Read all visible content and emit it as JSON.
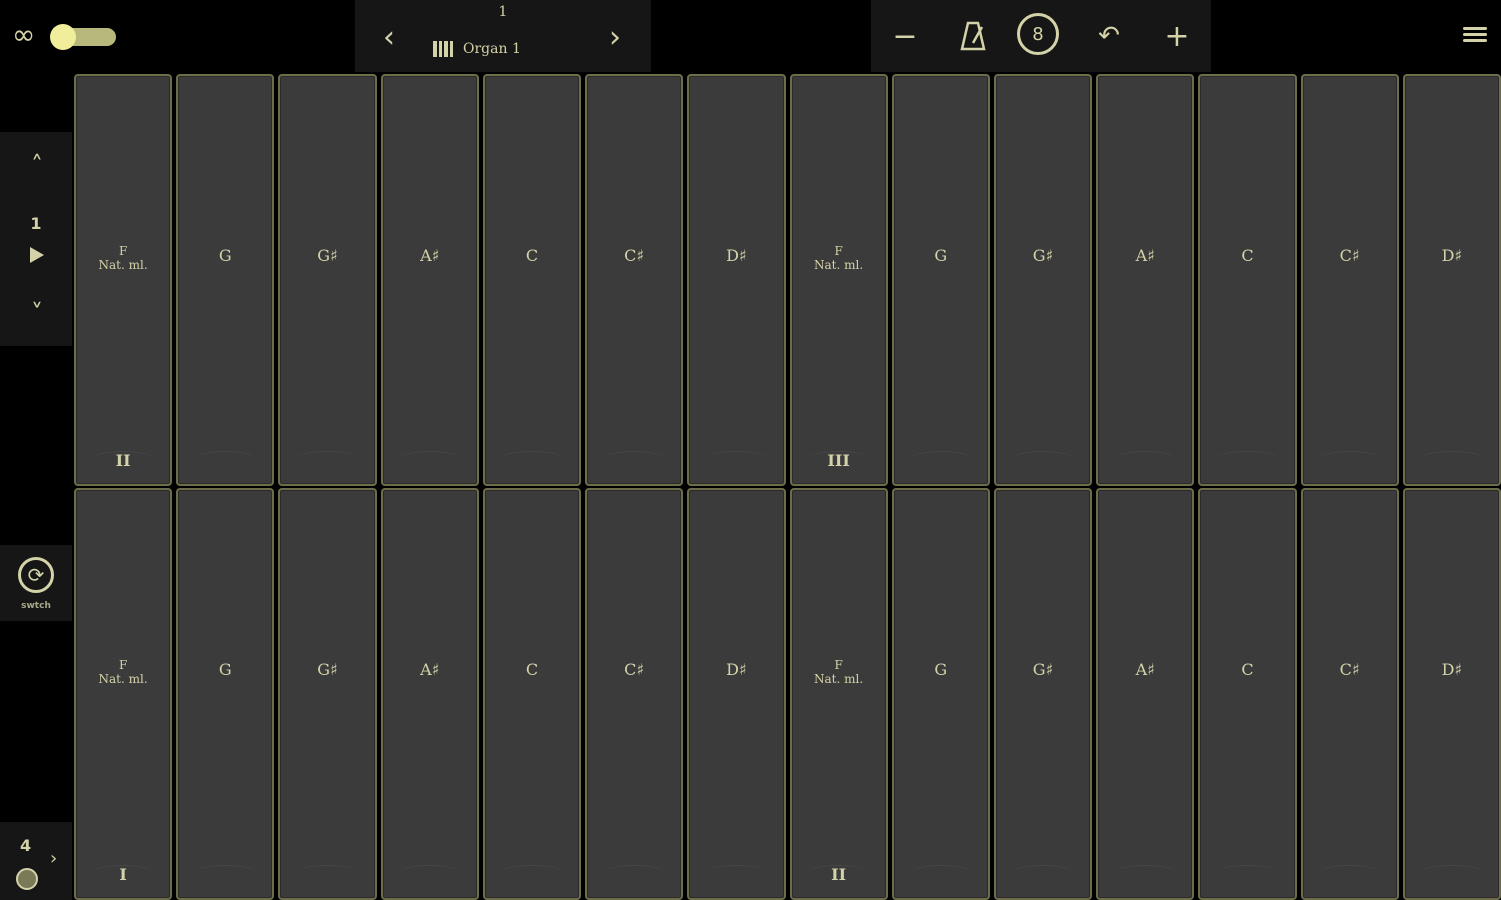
{
  "loop": {
    "infinity_symbol": "∞"
  },
  "preset": {
    "number": "1",
    "name": "Organ 1",
    "prev_symbol": "‹",
    "next_symbol": "›"
  },
  "tempo": {
    "minus_symbol": "−",
    "metronome_symbol": "𝄐",
    "count": "8",
    "undo_symbol": "↶",
    "plus_symbol": "+"
  },
  "octave": {
    "up_symbol": "˄",
    "down_symbol": "˅",
    "value": "1"
  },
  "swap": {
    "label": "swtch",
    "symbol": "⟳"
  },
  "bottom_left": {
    "number": "4",
    "chevron": "›"
  },
  "rows": {
    "top": [
      {
        "label": "F\nNat. ml.",
        "roman": "II"
      },
      {
        "label": "G",
        "roman": ""
      },
      {
        "label": "G♯",
        "roman": ""
      },
      {
        "label": "A♯",
        "roman": ""
      },
      {
        "label": "C",
        "roman": ""
      },
      {
        "label": "C♯",
        "roman": ""
      },
      {
        "label": "D♯",
        "roman": ""
      },
      {
        "label": "F\nNat. ml.",
        "roman": "III"
      },
      {
        "label": "G",
        "roman": ""
      },
      {
        "label": "G♯",
        "roman": ""
      },
      {
        "label": "A♯",
        "roman": ""
      },
      {
        "label": "C",
        "roman": ""
      },
      {
        "label": "C♯",
        "roman": ""
      },
      {
        "label": "D♯",
        "roman": ""
      }
    ],
    "bottom": [
      {
        "label": "F\nNat. ml.",
        "roman": "I"
      },
      {
        "label": "G",
        "roman": ""
      },
      {
        "label": "G♯",
        "roman": ""
      },
      {
        "label": "A♯",
        "roman": ""
      },
      {
        "label": "C",
        "roman": ""
      },
      {
        "label": "C♯",
        "roman": ""
      },
      {
        "label": "D♯",
        "roman": ""
      },
      {
        "label": "F\nNat. ml.",
        "roman": "II"
      },
      {
        "label": "G",
        "roman": ""
      },
      {
        "label": "G♯",
        "roman": ""
      },
      {
        "label": "A♯",
        "roman": ""
      },
      {
        "label": "C",
        "roman": ""
      },
      {
        "label": "C♯",
        "roman": ""
      },
      {
        "label": "D♯",
        "roman": ""
      }
    ]
  },
  "colors": {
    "accent": "#d8d48a",
    "key": "#3b3b3b",
    "background": "#000000"
  }
}
